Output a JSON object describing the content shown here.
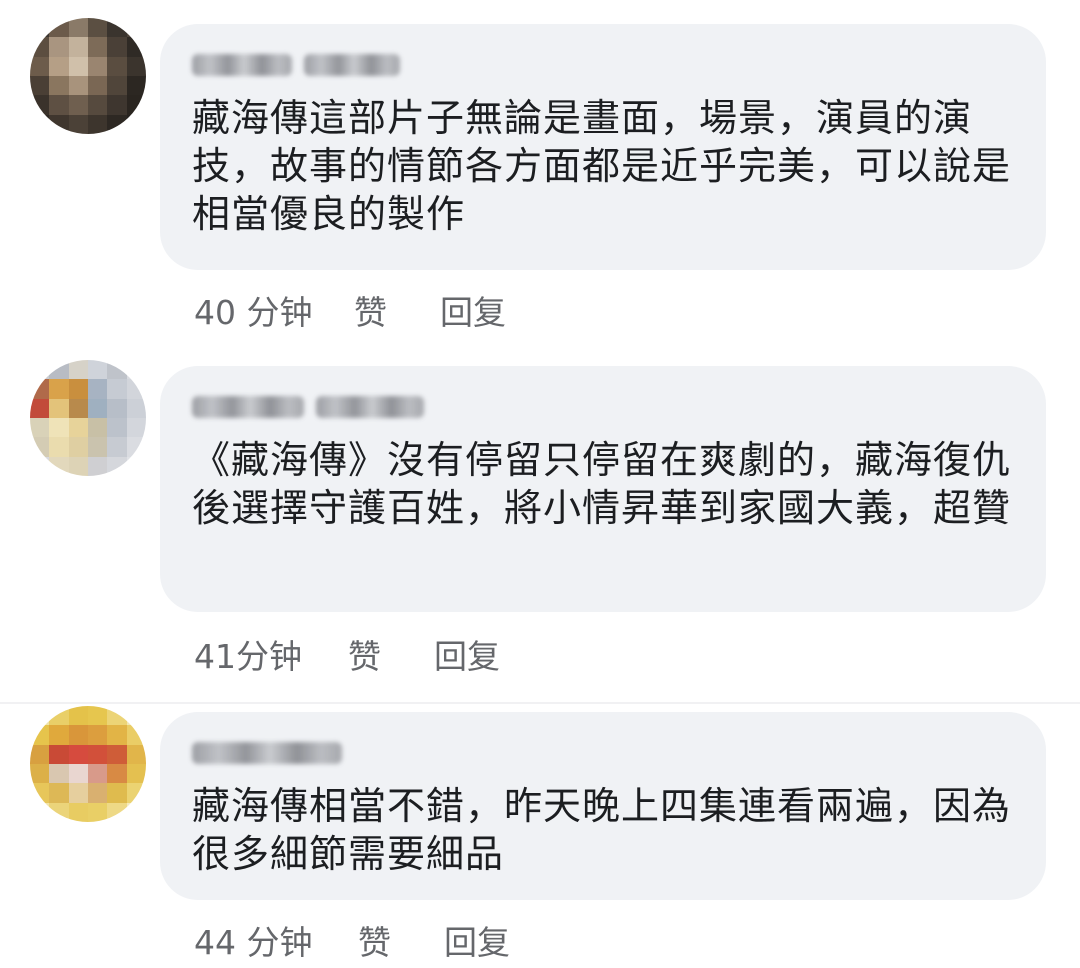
{
  "comments": [
    {
      "text": "藏海傳這部片子無論是畫面，場景，演員的演技，故事的情節各方面都是近乎完美，可以說是相當優良的製作",
      "time": "40 分钟",
      "like": "赞",
      "reply": "回复"
    },
    {
      "text": "《藏海傳》沒有停留只停留在爽劇的，藏海復仇後選擇守護百姓，將小情昇華到家國大義，超贊",
      "time": "41分钟",
      "like": "赞",
      "reply": "回复"
    },
    {
      "text": "藏海傳相當不錯，昨天晚上四集連看兩遍，因為很多細節需要細品",
      "time": "44 分钟",
      "like": "赞",
      "reply": "回复"
    }
  ],
  "colors": {
    "bubble": "#f0f2f5",
    "meta_text": "#65676b",
    "body_text": "#1c1e21"
  }
}
